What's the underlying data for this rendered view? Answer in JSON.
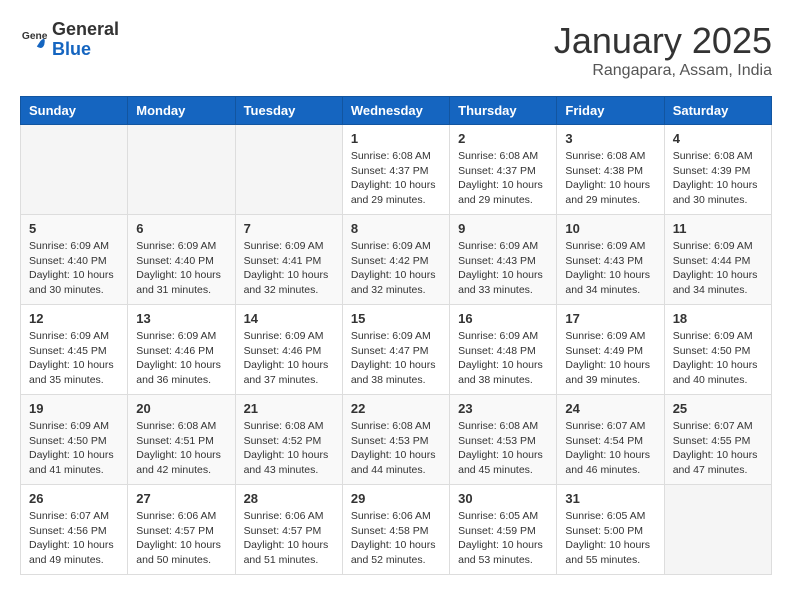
{
  "header": {
    "logo_general": "General",
    "logo_blue": "Blue",
    "title": "January 2025",
    "subtitle": "Rangapara, Assam, India"
  },
  "days_of_week": [
    "Sunday",
    "Monday",
    "Tuesday",
    "Wednesday",
    "Thursday",
    "Friday",
    "Saturday"
  ],
  "weeks": [
    [
      {
        "day": "",
        "info": ""
      },
      {
        "day": "",
        "info": ""
      },
      {
        "day": "",
        "info": ""
      },
      {
        "day": "1",
        "info": "Sunrise: 6:08 AM\nSunset: 4:37 PM\nDaylight: 10 hours\nand 29 minutes."
      },
      {
        "day": "2",
        "info": "Sunrise: 6:08 AM\nSunset: 4:37 PM\nDaylight: 10 hours\nand 29 minutes."
      },
      {
        "day": "3",
        "info": "Sunrise: 6:08 AM\nSunset: 4:38 PM\nDaylight: 10 hours\nand 29 minutes."
      },
      {
        "day": "4",
        "info": "Sunrise: 6:08 AM\nSunset: 4:39 PM\nDaylight: 10 hours\nand 30 minutes."
      }
    ],
    [
      {
        "day": "5",
        "info": "Sunrise: 6:09 AM\nSunset: 4:40 PM\nDaylight: 10 hours\nand 30 minutes."
      },
      {
        "day": "6",
        "info": "Sunrise: 6:09 AM\nSunset: 4:40 PM\nDaylight: 10 hours\nand 31 minutes."
      },
      {
        "day": "7",
        "info": "Sunrise: 6:09 AM\nSunset: 4:41 PM\nDaylight: 10 hours\nand 32 minutes."
      },
      {
        "day": "8",
        "info": "Sunrise: 6:09 AM\nSunset: 4:42 PM\nDaylight: 10 hours\nand 32 minutes."
      },
      {
        "day": "9",
        "info": "Sunrise: 6:09 AM\nSunset: 4:43 PM\nDaylight: 10 hours\nand 33 minutes."
      },
      {
        "day": "10",
        "info": "Sunrise: 6:09 AM\nSunset: 4:43 PM\nDaylight: 10 hours\nand 34 minutes."
      },
      {
        "day": "11",
        "info": "Sunrise: 6:09 AM\nSunset: 4:44 PM\nDaylight: 10 hours\nand 34 minutes."
      }
    ],
    [
      {
        "day": "12",
        "info": "Sunrise: 6:09 AM\nSunset: 4:45 PM\nDaylight: 10 hours\nand 35 minutes."
      },
      {
        "day": "13",
        "info": "Sunrise: 6:09 AM\nSunset: 4:46 PM\nDaylight: 10 hours\nand 36 minutes."
      },
      {
        "day": "14",
        "info": "Sunrise: 6:09 AM\nSunset: 4:46 PM\nDaylight: 10 hours\nand 37 minutes."
      },
      {
        "day": "15",
        "info": "Sunrise: 6:09 AM\nSunset: 4:47 PM\nDaylight: 10 hours\nand 38 minutes."
      },
      {
        "day": "16",
        "info": "Sunrise: 6:09 AM\nSunset: 4:48 PM\nDaylight: 10 hours\nand 38 minutes."
      },
      {
        "day": "17",
        "info": "Sunrise: 6:09 AM\nSunset: 4:49 PM\nDaylight: 10 hours\nand 39 minutes."
      },
      {
        "day": "18",
        "info": "Sunrise: 6:09 AM\nSunset: 4:50 PM\nDaylight: 10 hours\nand 40 minutes."
      }
    ],
    [
      {
        "day": "19",
        "info": "Sunrise: 6:09 AM\nSunset: 4:50 PM\nDaylight: 10 hours\nand 41 minutes."
      },
      {
        "day": "20",
        "info": "Sunrise: 6:08 AM\nSunset: 4:51 PM\nDaylight: 10 hours\nand 42 minutes."
      },
      {
        "day": "21",
        "info": "Sunrise: 6:08 AM\nSunset: 4:52 PM\nDaylight: 10 hours\nand 43 minutes."
      },
      {
        "day": "22",
        "info": "Sunrise: 6:08 AM\nSunset: 4:53 PM\nDaylight: 10 hours\nand 44 minutes."
      },
      {
        "day": "23",
        "info": "Sunrise: 6:08 AM\nSunset: 4:53 PM\nDaylight: 10 hours\nand 45 minutes."
      },
      {
        "day": "24",
        "info": "Sunrise: 6:07 AM\nSunset: 4:54 PM\nDaylight: 10 hours\nand 46 minutes."
      },
      {
        "day": "25",
        "info": "Sunrise: 6:07 AM\nSunset: 4:55 PM\nDaylight: 10 hours\nand 47 minutes."
      }
    ],
    [
      {
        "day": "26",
        "info": "Sunrise: 6:07 AM\nSunset: 4:56 PM\nDaylight: 10 hours\nand 49 minutes."
      },
      {
        "day": "27",
        "info": "Sunrise: 6:06 AM\nSunset: 4:57 PM\nDaylight: 10 hours\nand 50 minutes."
      },
      {
        "day": "28",
        "info": "Sunrise: 6:06 AM\nSunset: 4:57 PM\nDaylight: 10 hours\nand 51 minutes."
      },
      {
        "day": "29",
        "info": "Sunrise: 6:06 AM\nSunset: 4:58 PM\nDaylight: 10 hours\nand 52 minutes."
      },
      {
        "day": "30",
        "info": "Sunrise: 6:05 AM\nSunset: 4:59 PM\nDaylight: 10 hours\nand 53 minutes."
      },
      {
        "day": "31",
        "info": "Sunrise: 6:05 AM\nSunset: 5:00 PM\nDaylight: 10 hours\nand 55 minutes."
      },
      {
        "day": "",
        "info": ""
      }
    ]
  ]
}
